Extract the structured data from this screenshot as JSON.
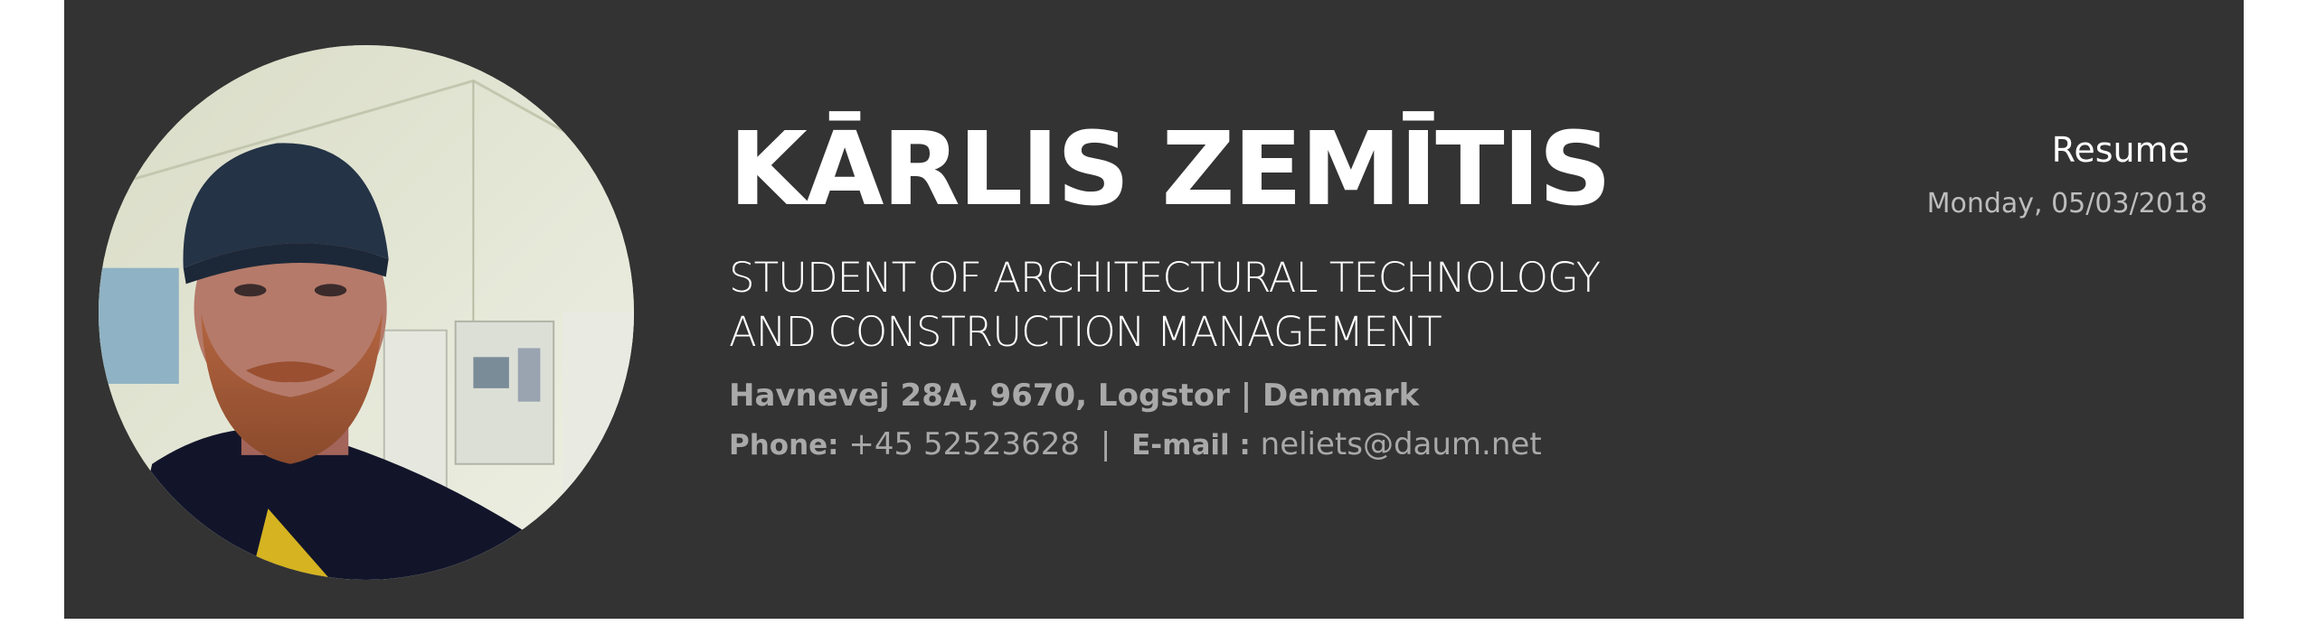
{
  "header": {
    "name": "KĀRLIS ZEMĪTIS",
    "title_line1": "STUDENT OF ARCHITECTURAL TECHNOLOGY",
    "title_line2": "AND CONSTRUCTION MANAGEMENT",
    "address": "Havnevej 28A, 9670, Logstor | Denmark",
    "contact": {
      "phone_label": "Phone:",
      "phone_value": "+45 52523628",
      "separator": "|",
      "email_label": "E-mail :",
      "email_value": "neliets@daum.net"
    }
  },
  "document": {
    "type": "Resume",
    "date": "Monday, 05/03/2018"
  },
  "colors": {
    "banner": "#333333",
    "name": "#ffffff",
    "muted": "#a9a9a9"
  }
}
